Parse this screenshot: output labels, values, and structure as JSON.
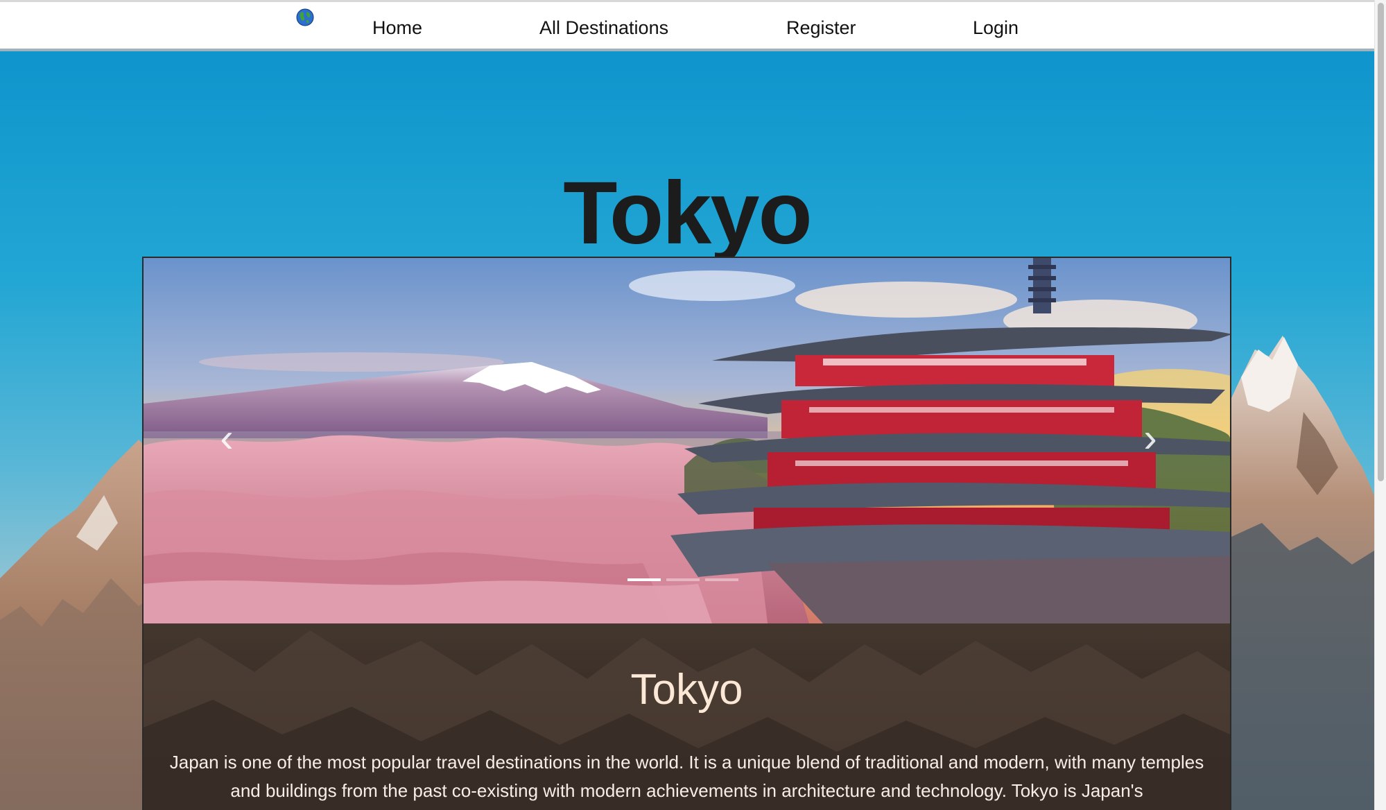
{
  "nav": {
    "logo_icon": "globe-icon",
    "links": [
      {
        "label": "Home"
      },
      {
        "label": "All Destinations"
      },
      {
        "label": "Register"
      },
      {
        "label": "Login"
      }
    ]
  },
  "hero": {
    "title": "Tokyo"
  },
  "carousel": {
    "prev_icon": "chevron-left-icon",
    "next_icon": "chevron-right-icon",
    "indicator_count": 3,
    "active_indicator": 1
  },
  "destination": {
    "title": "Tokyo",
    "description": "Japan is one of the most popular travel destinations in the world. It is a unique blend of traditional and modern, with many temples and buildings from the past co-existing with modern achievements in architecture and technology. Tokyo is Japan's"
  },
  "colors": {
    "sky": "#1fa0cf",
    "nav_bg": "#ffffff",
    "title_text": "#1c1c1c",
    "card_text": "#f7efe6"
  }
}
